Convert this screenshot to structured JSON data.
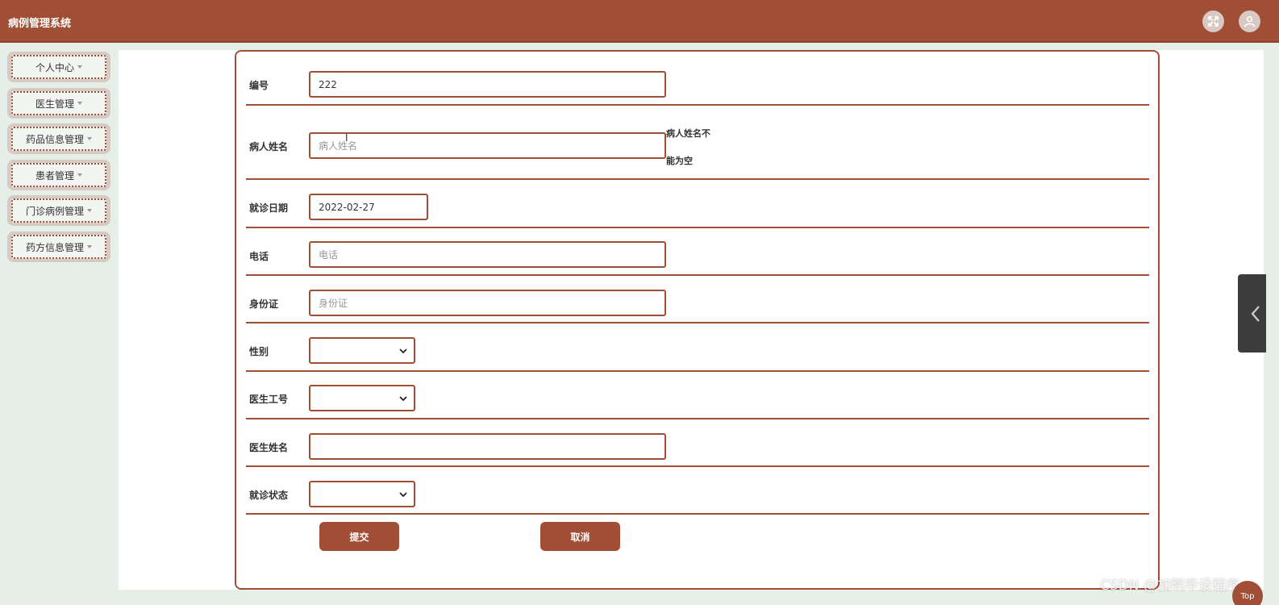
{
  "header": {
    "title": "病例管理系统",
    "icons": [
      "fullscreen-icon",
      "user-icon"
    ]
  },
  "sidebar": {
    "items": [
      {
        "label": "个人中心"
      },
      {
        "label": "医生管理"
      },
      {
        "label": "药品信息管理"
      },
      {
        "label": "患者管理"
      },
      {
        "label": "门诊病例管理"
      },
      {
        "label": "药方信息管理"
      }
    ]
  },
  "form": {
    "fields": {
      "number": {
        "label": "编号",
        "value": "222"
      },
      "patient_name": {
        "label": "病人姓名",
        "placeholder": "病人姓名",
        "error_line1": "病人姓名不",
        "error_line2": "能为空"
      },
      "visit_date": {
        "label": "就诊日期",
        "value": "2022-02-27"
      },
      "phone": {
        "label": "电话",
        "placeholder": "电话"
      },
      "id_card": {
        "label": "身份证",
        "placeholder": "身份证"
      },
      "gender": {
        "label": "性别",
        "value": ""
      },
      "doctor_id": {
        "label": "医生工号",
        "value": ""
      },
      "doctor_name": {
        "label": "医生姓名",
        "value": ""
      },
      "visit_status": {
        "label": "就诊状态",
        "value": ""
      }
    },
    "submit_label": "提交",
    "cancel_label": "取消"
  },
  "overlay": {
    "watermark": "CSDN @加明毕设程序",
    "top_label": "Top"
  },
  "colors": {
    "accent": "#a04e35",
    "background": "#e6eee8"
  }
}
